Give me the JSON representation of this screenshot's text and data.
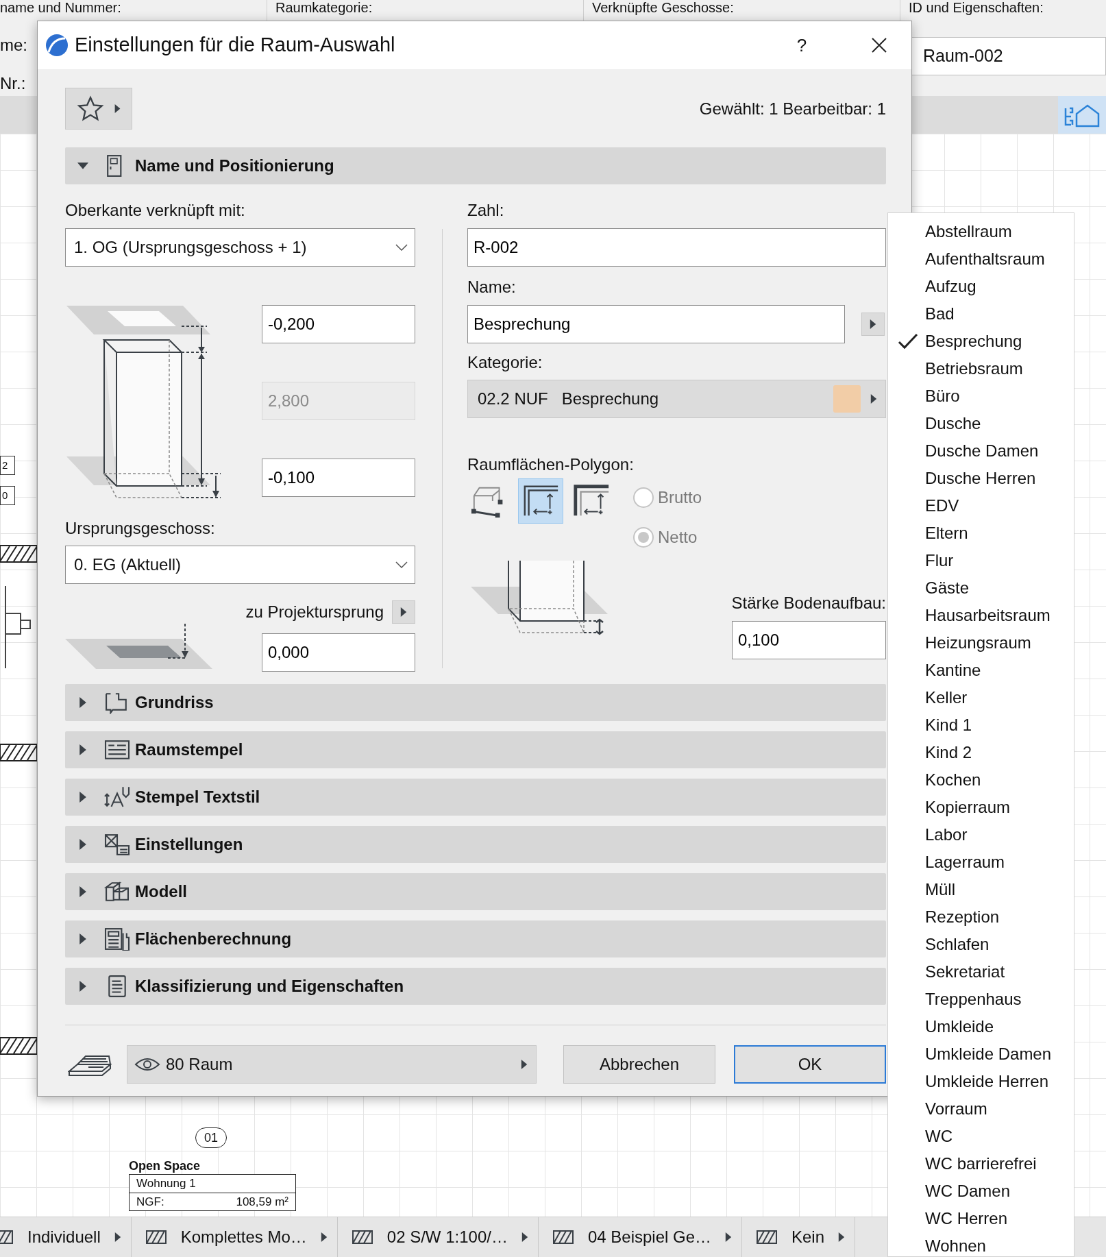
{
  "app": {
    "columns": [
      "name und Nummer:",
      "Raumkategorie:",
      "Verknüpfte Geschosse:",
      "ID und Eigenschaften:"
    ],
    "row_labels": [
      "me:",
      "Nr.:"
    ],
    "id_value": "Raum-002"
  },
  "canvas": {
    "wall_marks": [
      "2",
      "0"
    ],
    "room_stamp": {
      "number": "01",
      "name": "Open Space",
      "rows": [
        {
          "label": "Wohnung 1"
        },
        {
          "label": "NGF:",
          "value": "108,59 m²"
        }
      ]
    }
  },
  "dialog": {
    "title": "Einstellungen für die Raum-Auswahl",
    "help": "?",
    "selection_info": "Gewählt: 1 Bearbeitbar: 1",
    "sections": [
      {
        "title": "Name und Positionierung",
        "expanded": true
      },
      {
        "title": "Grundriss",
        "expanded": false
      },
      {
        "title": "Raumstempel",
        "expanded": false
      },
      {
        "title": "Stempel Textstil",
        "expanded": false
      },
      {
        "title": "Einstellungen",
        "expanded": false
      },
      {
        "title": "Modell",
        "expanded": false
      },
      {
        "title": "Flächenberechnung",
        "expanded": false
      },
      {
        "title": "Klassifizierung und Eigenschaften",
        "expanded": false
      }
    ],
    "positioning": {
      "top_link": {
        "label": "Oberkante verknüpft mit:",
        "value": "1. OG (Ursprungsgeschoss + 1)"
      },
      "top_offset": {
        "value": "-0,200"
      },
      "height": {
        "value": "2,800",
        "disabled": true
      },
      "bottom_offset": {
        "value": "-0,100"
      },
      "home_story": {
        "label": "Ursprungsgeschoss:",
        "value": "0. EG (Aktuell)"
      },
      "reference": {
        "label": "zu Projektursprung",
        "value": "0,000"
      },
      "number": {
        "label": "Zahl:",
        "value": "R-002"
      },
      "name": {
        "label": "Name:",
        "value": "Besprechung"
      },
      "category": {
        "label": "Kategorie:",
        "code": "02.2 NUF",
        "name": "Besprechung",
        "color": "#f2cda7"
      },
      "polygon": {
        "label": "Raumflächen-Polygon:",
        "modes": [
          {
            "selected": false
          },
          {
            "selected": true
          },
          {
            "selected": false
          }
        ],
        "options": [
          {
            "label": "Brutto",
            "selected": false,
            "disabled": true
          },
          {
            "label": "Netto",
            "selected": true,
            "disabled": true
          }
        ]
      },
      "floor": {
        "label": "Stärke Bodenaufbau:",
        "value": "0,100"
      }
    },
    "footer": {
      "layer": "80 Raum",
      "buttons": [
        {
          "label": "Abbrechen",
          "default": false
        },
        {
          "label": "OK",
          "default": true
        }
      ]
    }
  },
  "name_list": [
    {
      "label": "Abstellraum",
      "selected": false
    },
    {
      "label": "Aufenthaltsraum",
      "selected": false
    },
    {
      "label": "Aufzug",
      "selected": false
    },
    {
      "label": "Bad",
      "selected": false
    },
    {
      "label": "Besprechung",
      "selected": true
    },
    {
      "label": "Betriebsraum",
      "selected": false
    },
    {
      "label": "Büro",
      "selected": false
    },
    {
      "label": "Dusche",
      "selected": false
    },
    {
      "label": "Dusche Damen",
      "selected": false
    },
    {
      "label": "Dusche Herren",
      "selected": false
    },
    {
      "label": "EDV",
      "selected": false
    },
    {
      "label": "Eltern",
      "selected": false
    },
    {
      "label": "Flur",
      "selected": false
    },
    {
      "label": "Gäste",
      "selected": false
    },
    {
      "label": "Hausarbeitsraum",
      "selected": false
    },
    {
      "label": "Heizungsraum",
      "selected": false
    },
    {
      "label": "Kantine",
      "selected": false
    },
    {
      "label": "Keller",
      "selected": false
    },
    {
      "label": "Kind 1",
      "selected": false
    },
    {
      "label": "Kind 2",
      "selected": false
    },
    {
      "label": "Kochen",
      "selected": false
    },
    {
      "label": "Kopierraum",
      "selected": false
    },
    {
      "label": "Labor",
      "selected": false
    },
    {
      "label": "Lagerraum",
      "selected": false
    },
    {
      "label": "Müll",
      "selected": false
    },
    {
      "label": "Rezeption",
      "selected": false
    },
    {
      "label": "Schlafen",
      "selected": false
    },
    {
      "label": "Sekretariat",
      "selected": false
    },
    {
      "label": "Treppenhaus",
      "selected": false
    },
    {
      "label": "Umkleide",
      "selected": false
    },
    {
      "label": "Umkleide Damen",
      "selected": false
    },
    {
      "label": "Umkleide Herren",
      "selected": false
    },
    {
      "label": "Vorraum",
      "selected": false
    },
    {
      "label": "WC",
      "selected": false
    },
    {
      "label": "WC barrierefrei",
      "selected": false
    },
    {
      "label": "WC Damen",
      "selected": false
    },
    {
      "label": "WC Herren",
      "selected": false
    },
    {
      "label": "Wohnen",
      "selected": false
    }
  ],
  "status_bar": [
    "Individuell",
    "Komplettes Mo…",
    "02 S/W 1:100/…",
    "04 Beispiel Ge…",
    "Kein"
  ]
}
